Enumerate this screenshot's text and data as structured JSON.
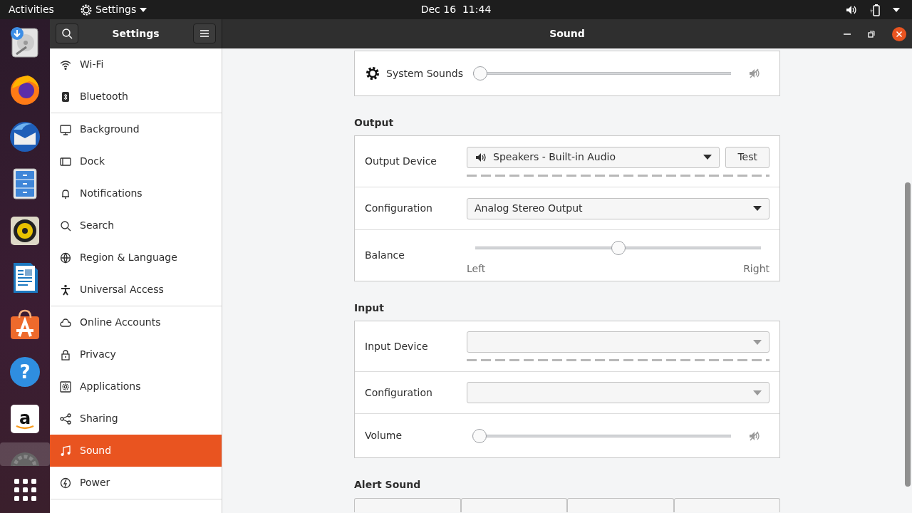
{
  "top_bar": {
    "activities": "Activities",
    "app_menu": "Settings",
    "clock": "Dec 16  11:44"
  },
  "dock": [
    {
      "kind": "disk",
      "selected": false
    },
    {
      "kind": "browser",
      "selected": false
    },
    {
      "kind": "mail",
      "selected": false
    },
    {
      "kind": "files",
      "selected": false
    },
    {
      "kind": "music",
      "selected": false
    },
    {
      "kind": "writer",
      "selected": false
    },
    {
      "kind": "store",
      "selected": false
    },
    {
      "kind": "help",
      "glyph": "?",
      "selected": false
    },
    {
      "kind": "amazon",
      "glyph": "a",
      "selected": false
    },
    {
      "kind": "settings",
      "selected": true
    }
  ],
  "sidebar": {
    "title": "Settings",
    "sections": [
      {
        "items": [
          {
            "label": "Wi-Fi",
            "selected": false
          },
          {
            "label": "Bluetooth",
            "selected": false
          }
        ]
      },
      {
        "items": [
          {
            "label": "Background",
            "selected": false
          },
          {
            "label": "Dock",
            "selected": false
          },
          {
            "label": "Notifications",
            "selected": false
          },
          {
            "label": "Search",
            "selected": false
          },
          {
            "label": "Region & Language",
            "selected": false
          },
          {
            "label": "Universal Access",
            "selected": false
          }
        ]
      },
      {
        "items": [
          {
            "label": "Online Accounts",
            "selected": false
          },
          {
            "label": "Privacy",
            "selected": false
          },
          {
            "label": "Applications",
            "selected": false
          },
          {
            "label": "Sharing",
            "selected": false
          },
          {
            "label": "Sound",
            "selected": true
          },
          {
            "label": "Power",
            "selected": false
          }
        ]
      }
    ]
  },
  "window": {
    "title": "Sound"
  },
  "system_sounds": {
    "label": "System Sounds",
    "level": 0,
    "muted": true
  },
  "output": {
    "heading": "Output",
    "device": {
      "label": "Output Device",
      "value": "Speakers - Built-in Audio",
      "button": "Test"
    },
    "configuration": {
      "label": "Configuration",
      "value": "Analog Stereo Output"
    },
    "balance": {
      "label": "Balance",
      "level": 0.5,
      "left": "Left",
      "right": "Right"
    }
  },
  "input": {
    "heading": "Input",
    "device": {
      "label": "Input Device"
    },
    "configuration": {
      "label": "Configuration"
    },
    "volume": {
      "label": "Volume",
      "level": 0,
      "muted": true
    }
  },
  "alert_sound": {
    "heading": "Alert Sound"
  }
}
